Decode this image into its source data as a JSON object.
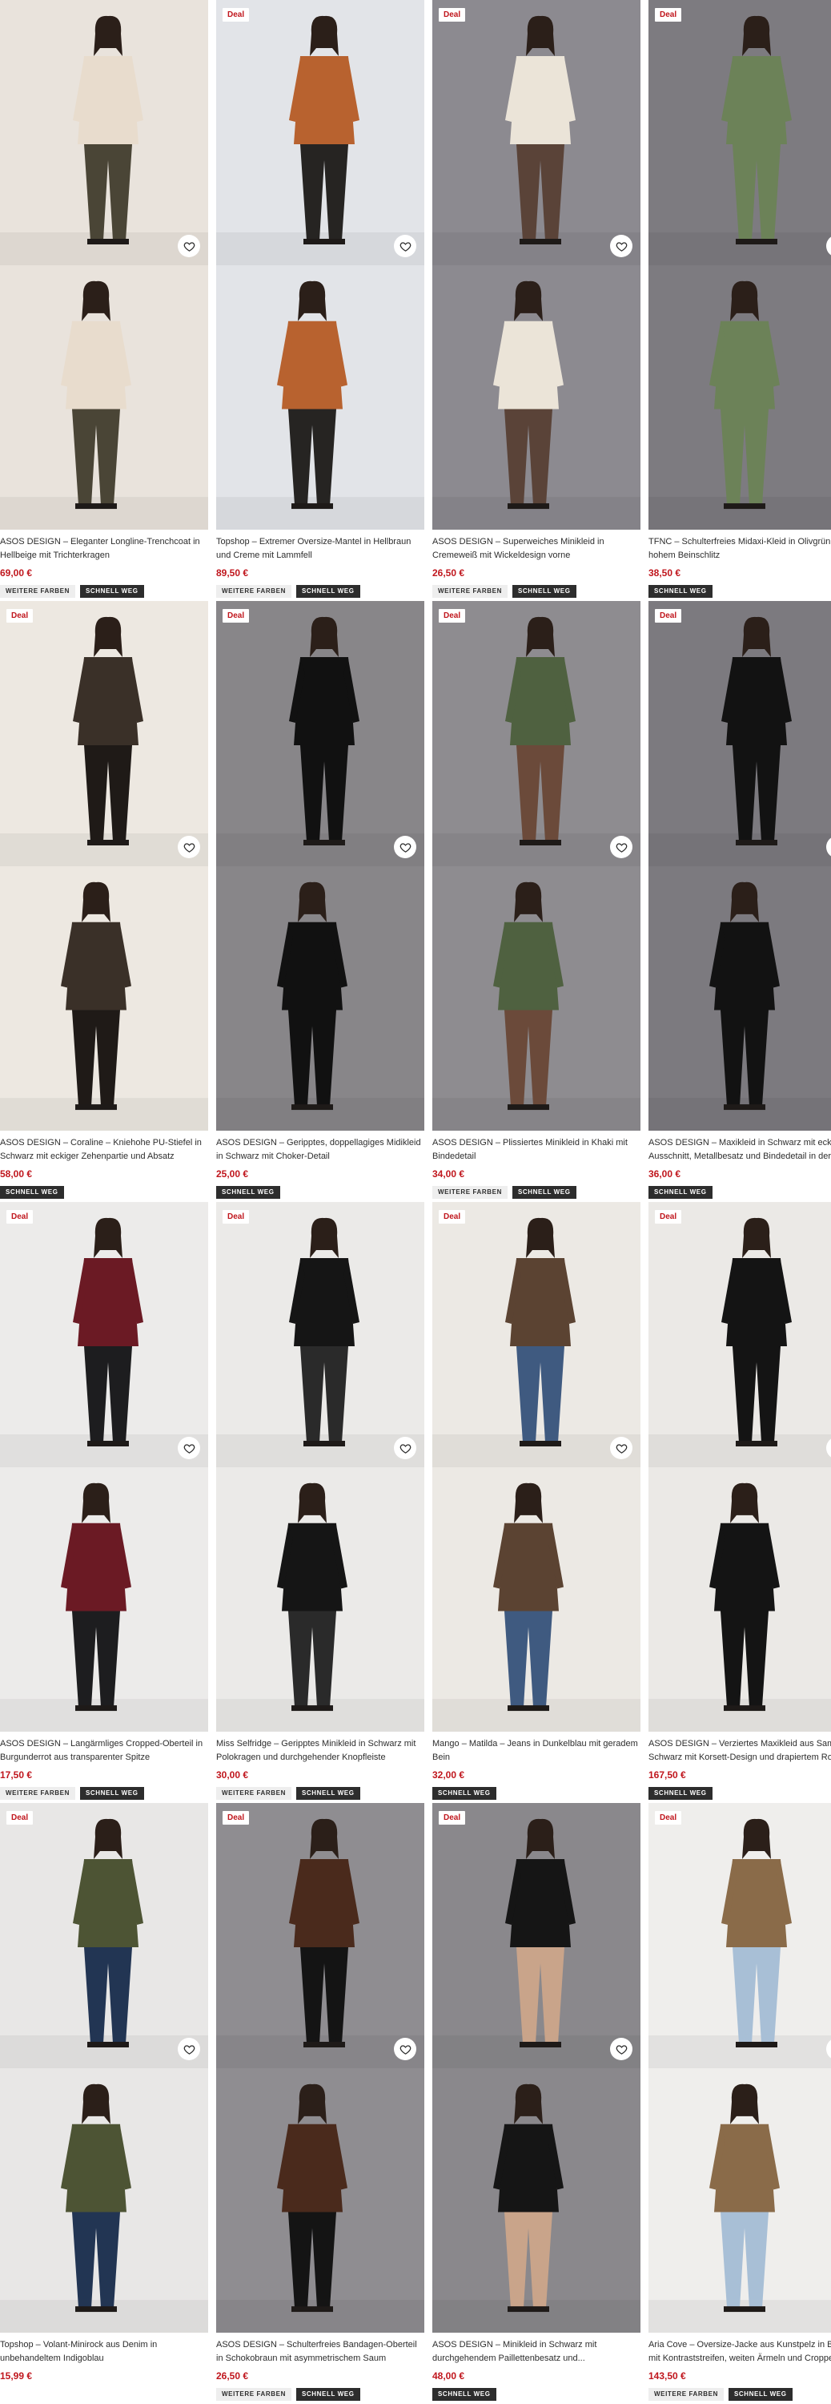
{
  "deal_label": "Deal",
  "badge_colors": "WEITERE FARBEN",
  "badge_fast": "SCHNELL WEG",
  "accent_color": "#c0161d",
  "products": [
    {
      "title": "ASOS DESIGN – Eleganter Longline-Trenchcoat in Hellbeige mit Trichterkragen",
      "price": "69,00 €",
      "deal": false,
      "colors": true,
      "fast": true,
      "bg": "#e9e3dc",
      "fig": "#e8dccd",
      "legs": "#4a4536"
    },
    {
      "title": "Topshop – Extremer Oversize-Mantel in Hellbraun und Creme mit Lammfell",
      "price": "89,50 €",
      "deal": true,
      "colors": true,
      "fast": true,
      "bg": "#e2e4e8",
      "fig": "#b8622f",
      "legs": "#262422"
    },
    {
      "title": "ASOS DESIGN – Superweiches Minikleid in Cremeweiß mit Wickeldesign vorne",
      "price": "26,50 €",
      "deal": true,
      "colors": true,
      "fast": true,
      "bg": "#8c8a90",
      "fig": "#ebe4d8",
      "legs": "#5a4338"
    },
    {
      "title": "TFNC – Schulterfreies Midaxi-Kleid in Olivgrün mit hohem Beinschlitz",
      "price": "38,50 €",
      "deal": true,
      "colors": false,
      "fast": true,
      "bg": "#7d7b80",
      "fig": "#6c8258",
      "legs": "#6c8258"
    },
    {
      "title": "ASOS DESIGN – Coraline – Kniehohe PU-Stiefel in Schwarz mit eckiger Zehenpartie und Absatz",
      "price": "58,00 €",
      "deal": true,
      "colors": false,
      "fast": true,
      "bg": "#ede8e1",
      "fig": "#3a3028",
      "legs": "#1f1a17"
    },
    {
      "title": "ASOS DESIGN – Geripptes, doppellagiges Midikleid in Schwarz mit Choker-Detail",
      "price": "25,00 €",
      "deal": true,
      "colors": false,
      "fast": true,
      "bg": "#888689",
      "fig": "#111111",
      "legs": "#111111"
    },
    {
      "title": "ASOS DESIGN – Plissiertes Minikleid in Khaki mit Bindedetail",
      "price": "34,00 €",
      "deal": true,
      "colors": true,
      "fast": true,
      "bg": "#8e8c90",
      "fig": "#4f6140",
      "legs": "#6b4a3a"
    },
    {
      "title": "ASOS DESIGN – Maxikleid in Schwarz mit eckigem Ausschnitt, Metallbesatz und Bindedetail in der Taille",
      "price": "36,00 €",
      "deal": true,
      "colors": false,
      "fast": true,
      "bg": "#7c7a7f",
      "fig": "#121212",
      "legs": "#121212"
    },
    {
      "title": "ASOS DESIGN – Langärmliges Cropped-Oberteil in Burgunderrot aus transparenter Spitze",
      "price": "17,50 €",
      "deal": true,
      "colors": true,
      "fast": true,
      "bg": "#ecebea",
      "fig": "#6b1a24",
      "legs": "#1d1d1f"
    },
    {
      "title": "Miss Selfridge – Geripptes Minikleid in Schwarz mit Polokragen und durchgehender Knopfleiste",
      "price": "30,00 €",
      "deal": true,
      "colors": true,
      "fast": true,
      "bg": "#ebeae8",
      "fig": "#151515",
      "legs": "#2a2a2a"
    },
    {
      "title": "Mango – Matilda – Jeans in Dunkelblau mit geradem Bein",
      "price": "32,00 €",
      "deal": true,
      "colors": false,
      "fast": true,
      "bg": "#ece9e4",
      "fig": "#5b4332",
      "legs": "#3f5a80"
    },
    {
      "title": "ASOS DESIGN – Verziertes Maxikleid aus Samt in Schwarz mit Korsett-Design und drapiertem Rock",
      "price": "167,50 €",
      "deal": true,
      "colors": false,
      "fast": true,
      "bg": "#ebe9e6",
      "fig": "#141414",
      "legs": "#141414"
    },
    {
      "title": "Topshop – Volant-Minirock aus Denim in unbehandeltem Indigoblau",
      "price": "15,99 €",
      "deal": true,
      "colors": false,
      "fast": false,
      "bg": "#e8e7e6",
      "fig": "#4d5434",
      "legs": "#223553"
    },
    {
      "title": "ASOS DESIGN – Schulterfreies Bandagen-Oberteil in Schokobraun mit asymmetrischem Saum",
      "price": "26,50 €",
      "deal": true,
      "colors": true,
      "fast": true,
      "bg": "#8f8d91",
      "fig": "#4a2a1c",
      "legs": "#141414"
    },
    {
      "title": "ASOS DESIGN – Minikleid in Schwarz mit durchgehendem Paillettenbesatz und...",
      "price": "48,00 €",
      "deal": true,
      "colors": false,
      "fast": true,
      "bg": "#8a888c",
      "fig": "#151515",
      "legs": "#c9a48a"
    },
    {
      "title": "Aria Cove – Oversize-Jacke aus Kunstpelz in Braun mit Kontraststreifen, weiten Ärmeln und Cropped-Schnitt",
      "price": "143,50 €",
      "deal": true,
      "colors": true,
      "fast": true,
      "bg": "#efeeec",
      "fig": "#8a6b49",
      "legs": "#a8bfd6"
    }
  ]
}
